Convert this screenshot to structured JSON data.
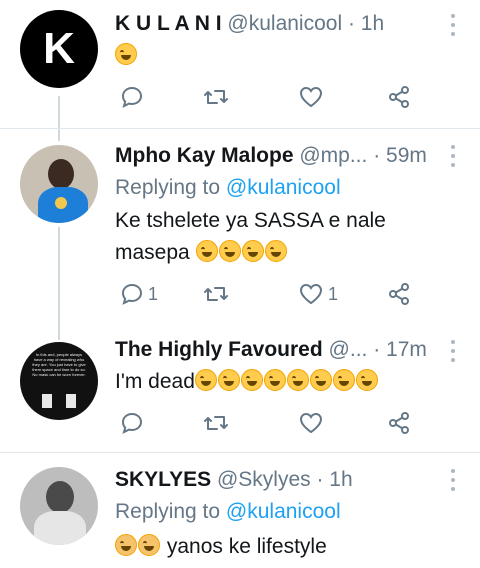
{
  "tweets": [
    {
      "name": "K U L A N I",
      "handle": "@kulanicool",
      "time": "· 1h",
      "avatar_letter": "K",
      "replying_label": "",
      "mention": "",
      "text": "",
      "emojis": [
        "rofl"
      ],
      "reply_count": "",
      "like_count": ""
    },
    {
      "name": "Mpho Kay Malope",
      "handle": "@mp...",
      "time": "· 59m",
      "replying_label": "Replying to",
      "mention": "@kulanicool",
      "text_line1": "Ke tshelete ya SASSA e nale",
      "text_line2": "masepa",
      "emojis": [
        "joy",
        "joy",
        "joy",
        "joy"
      ],
      "reply_count": "1",
      "like_count": "1"
    },
    {
      "name": "The Highly Favoured",
      "handle": "@...",
      "time": "· 17m",
      "replying_label": "",
      "mention": "",
      "text": "I'm dead",
      "emojis": [
        "rofl",
        "rofl",
        "rofl",
        "rofl",
        "rofl",
        "rofl",
        "rofl",
        "rofl"
      ],
      "avatar_quote": "In this and, people always have a way of revealing who they are. You just have to give them space and time to do so. No mask can be worn forever.",
      "reply_count": "",
      "like_count": ""
    },
    {
      "name": "SKYLYES",
      "handle": "@Skylyes",
      "time": "· 1h",
      "replying_label": "Replying to",
      "mention": "@kulanicool",
      "text": "yanos ke lifestyle",
      "emojis": [
        "joy_cat",
        "joy_cat"
      ]
    }
  ],
  "colors": {
    "accent": "#1da1f2",
    "secondary": "#657786",
    "divider": "#e1e8ed"
  },
  "icons": [
    "reply-icon",
    "retweet-icon",
    "like-icon",
    "share-icon",
    "more-icon"
  ]
}
